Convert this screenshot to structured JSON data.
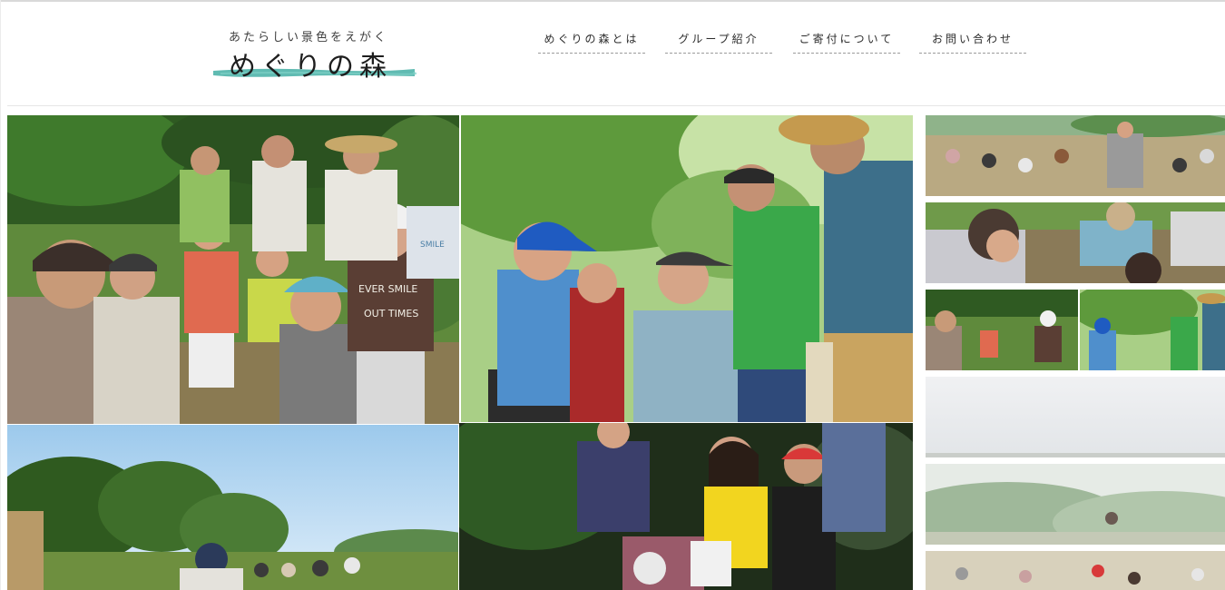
{
  "site": {
    "logo_tagline": "あたらしい景色をえがく",
    "logo_title": "めぐりの森"
  },
  "nav": {
    "items": [
      {
        "label": "めぐりの森とは"
      },
      {
        "label": "グループ紹介"
      },
      {
        "label": "ご寄付について"
      },
      {
        "label": "お問い合わせ"
      }
    ]
  },
  "photos": {
    "tshirt_print": "EVER SMILE",
    "tshirt_print_2": "OUT TIMES",
    "bag_print": "SMILE"
  },
  "colors": {
    "brand_teal": "#4fb4aa",
    "nav_text": "#2c2c2c",
    "border": "#e6e6e6"
  }
}
